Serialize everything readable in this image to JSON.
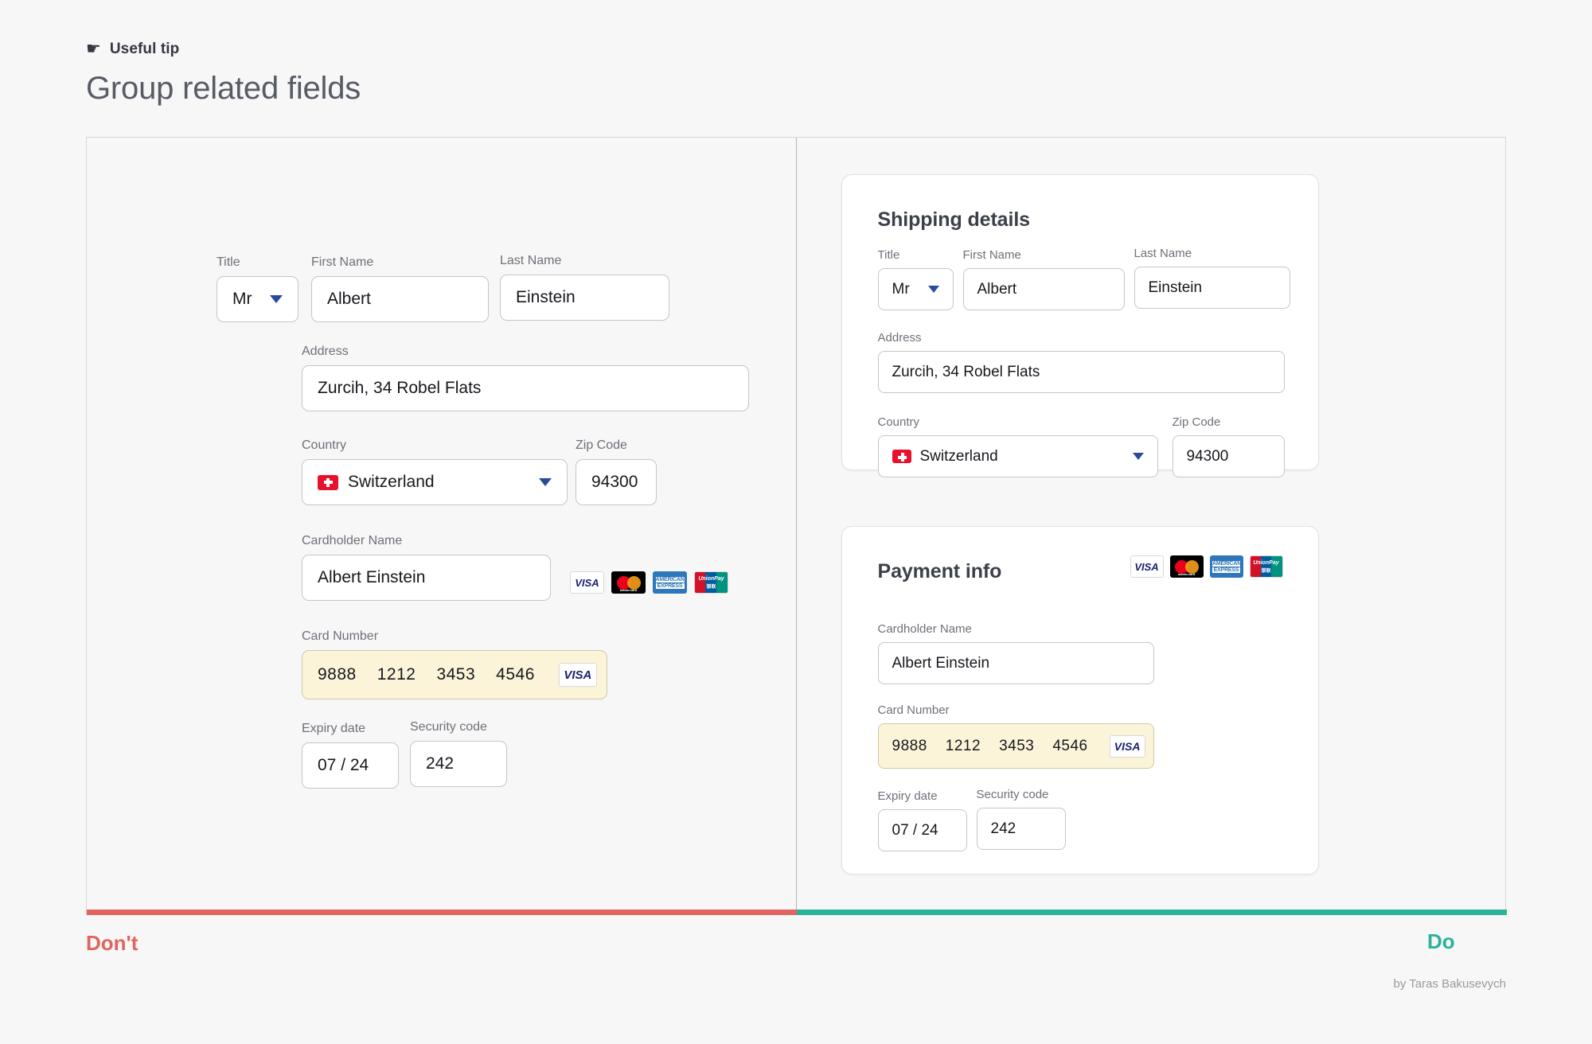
{
  "header": {
    "tip_icon": "pointing-hand",
    "tip_glyph": "☛",
    "tip_label": "Useful tip",
    "title": "Group related fields"
  },
  "labels": {
    "title": "Title",
    "first_name": "First Name",
    "last_name": "Last Name",
    "address": "Address",
    "country": "Country",
    "zip_code": "Zip Code",
    "cardholder_name": "Cardholder Name",
    "card_number": "Card Number",
    "expiry_date": "Expiry date",
    "security_code": "Security code"
  },
  "values": {
    "title": "Mr",
    "first_name": "Albert",
    "last_name": "Einstein",
    "address": "Zurcih, 34 Robel Flats",
    "country": "Switzerland",
    "zip_code": "94300",
    "cardholder_name": "Albert Einstein",
    "card_group_1": "9888",
    "card_group_2": "1212",
    "card_group_3": "3453",
    "card_group_4": "4546",
    "expiry_date": "07 / 24",
    "security_code": "242"
  },
  "brands": {
    "visa": "VISA",
    "mastercard": "mastercard",
    "amex_line1": "AMERICAN",
    "amex_line2": "EXPRESS",
    "unionpay": "UnionPay",
    "unionpay_cn": "银联"
  },
  "right": {
    "shipping_title": "Shipping details",
    "payment_title": "Payment info"
  },
  "footer": {
    "dont": "Don't",
    "do": "Do",
    "credit": "by Taras Bakusevych"
  },
  "colors": {
    "dont": "#e0655f",
    "do": "#2bb29b",
    "highlight_bg": "#fbf4d9",
    "accent_blue": "#2a4a9c",
    "flag_red": "#e8112d"
  }
}
